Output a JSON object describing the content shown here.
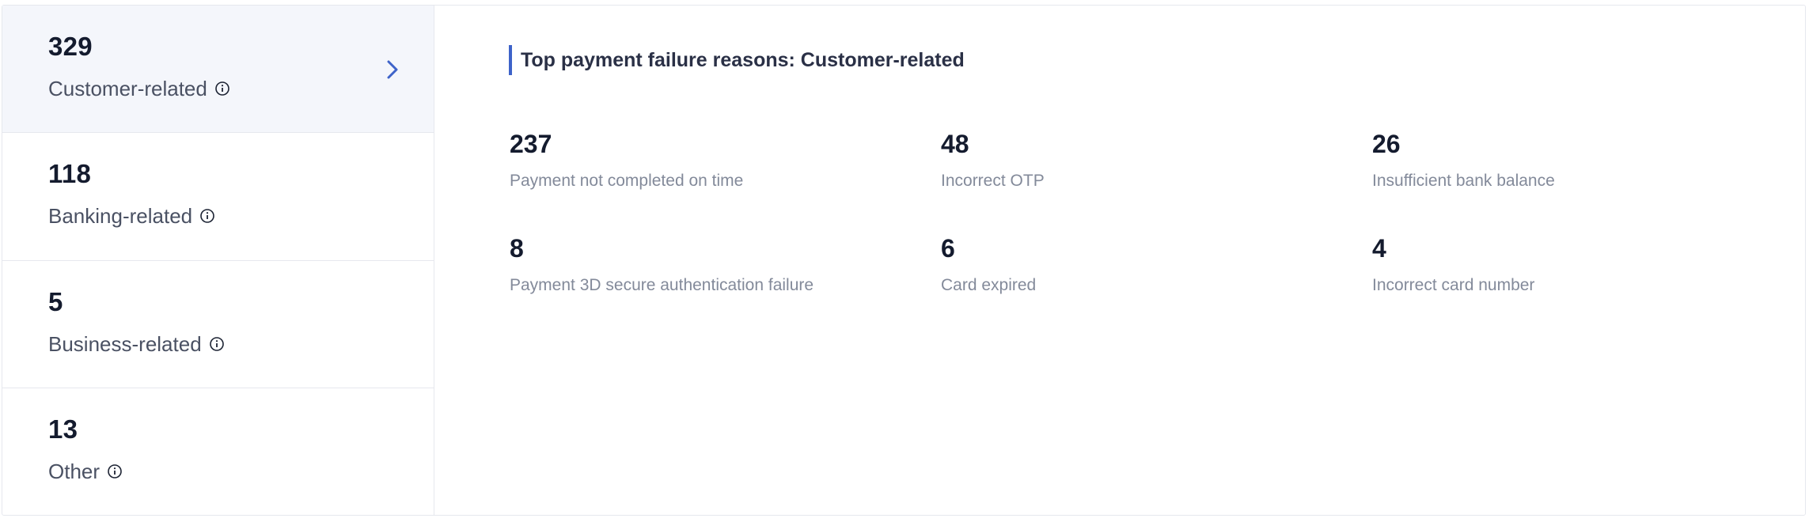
{
  "sidebar": {
    "items": [
      {
        "count": "329",
        "label": "Customer-related"
      },
      {
        "count": "118",
        "label": "Banking-related"
      },
      {
        "count": "5",
        "label": "Business-related"
      },
      {
        "count": "13",
        "label": "Other"
      }
    ]
  },
  "main": {
    "title": "Top payment failure reasons: Customer-related",
    "reasons": [
      {
        "count": "237",
        "label": "Payment not completed on time"
      },
      {
        "count": "48",
        "label": "Incorrect OTP"
      },
      {
        "count": "26",
        "label": "Insufficient bank balance"
      },
      {
        "count": "8",
        "label": "Payment 3D secure authentication failure"
      },
      {
        "count": "6",
        "label": "Card expired"
      },
      {
        "count": "4",
        "label": "Incorrect card number"
      }
    ]
  },
  "icons": {
    "info": "info-icon",
    "chevron": "chevron-right-icon"
  },
  "colors": {
    "accent": "#3e63c9",
    "active_bg": "#f4f6fb",
    "border": "#e6e8ee",
    "muted_text": "#838a9a"
  }
}
